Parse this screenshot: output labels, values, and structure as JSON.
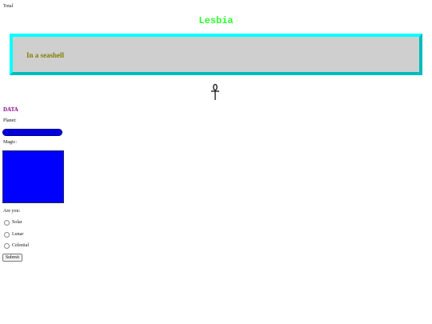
{
  "top_label": "Total",
  "site_title": "Lesbia",
  "banner": {
    "text": "In a seashell"
  },
  "icons": {
    "center": "ankh-icon"
  },
  "form": {
    "heading": "DATA",
    "planet_label": "Planet:",
    "planet_selected": "",
    "magic_label": "Magic:",
    "magic_value": "",
    "question_label": "Are you:",
    "options": [
      {
        "label": "Solar"
      },
      {
        "label": "Lunar"
      },
      {
        "label": "Celestial"
      }
    ],
    "submit_label": "Submit"
  },
  "colors": {
    "title": "#2cff2c",
    "banner_bg": "#cfcfcf",
    "banner_border": "#00ffff",
    "banner_text": "#808000",
    "heading": "#8b008b",
    "select_bg": "#0000dd",
    "textarea_bg": "#0000ff"
  }
}
